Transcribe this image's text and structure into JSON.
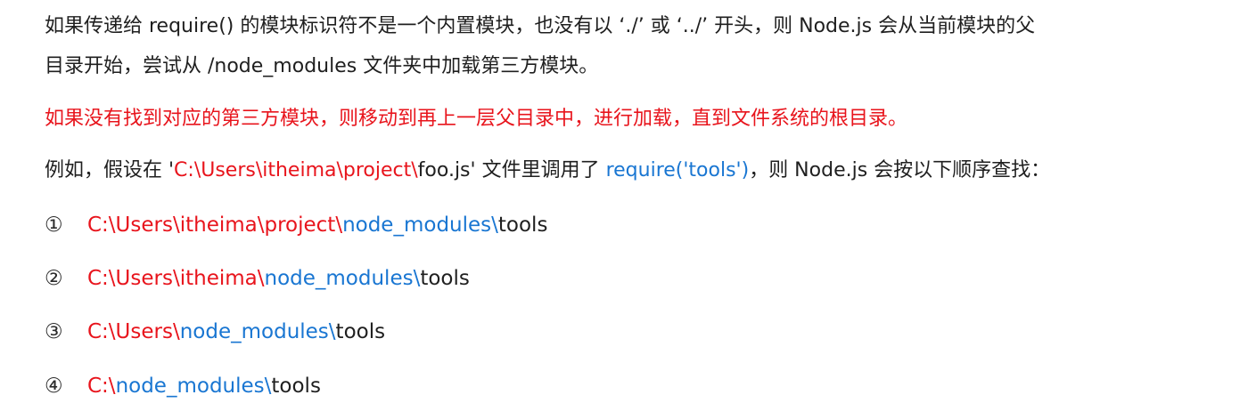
{
  "paragraph1": {
    "line1": "如果传递给 require() 的模块标识符不是一个内置模块，也没有以 ‘./’ 或 ‘../’ 开头，则 Node.js 会从当前模块的父",
    "line2": "目录开始，尝试从 /node_modules 文件夹中加载第三方模块。"
  },
  "paragraph2": {
    "text": "如果没有找到对应的第三方模块，则移动到再上一层父目录中，进行加载，直到文件系统的根目录。"
  },
  "paragraph3": {
    "prefix": "例如，假设在 '",
    "path_red": "C:\\Users\\itheima\\project\\",
    "filename": "foo.js",
    "middle": "' 文件里调用了 ",
    "call_blue": "require('tools')",
    "suffix": "，则 Node.js 会按以下顺序查找："
  },
  "search_order": [
    {
      "number": "①",
      "red": "C:\\Users\\itheima\\project\\",
      "blue": "node_modules\\",
      "tail": "tools"
    },
    {
      "number": "②",
      "red": "C:\\Users\\itheima\\",
      "blue": "node_modules\\",
      "tail": "tools"
    },
    {
      "number": "③",
      "red": "C:\\Users\\",
      "blue": "node_modules\\",
      "tail": "tools"
    },
    {
      "number": "④",
      "red": "C:\\",
      "blue": "node_modules\\",
      "tail": "tools"
    }
  ],
  "colors": {
    "text": "#1f1f1f",
    "highlight_red": "#e8141c",
    "highlight_blue": "#1976d2",
    "background": "#ffffff"
  }
}
